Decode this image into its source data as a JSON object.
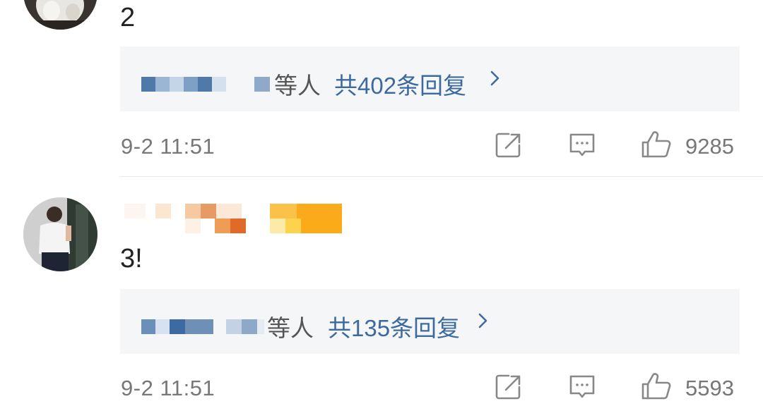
{
  "comments": [
    {
      "text": "2",
      "reply_suffix": "等人",
      "reply_count": "共402条回复",
      "time": "9-2 11:51",
      "likes": "9285"
    },
    {
      "text": "3!",
      "reply_suffix": "等人",
      "reply_count": "共135条回复",
      "time": "9-2 11:51",
      "likes": "5593"
    }
  ],
  "icons": {
    "share": "share-icon",
    "comment": "comment-icon",
    "like": "thumbs-up-icon",
    "chevron": "chevron-right-icon"
  },
  "colors": {
    "link": "#3d6a9e",
    "meta_text": "#777777",
    "reply_background": "#f5f6f8"
  }
}
